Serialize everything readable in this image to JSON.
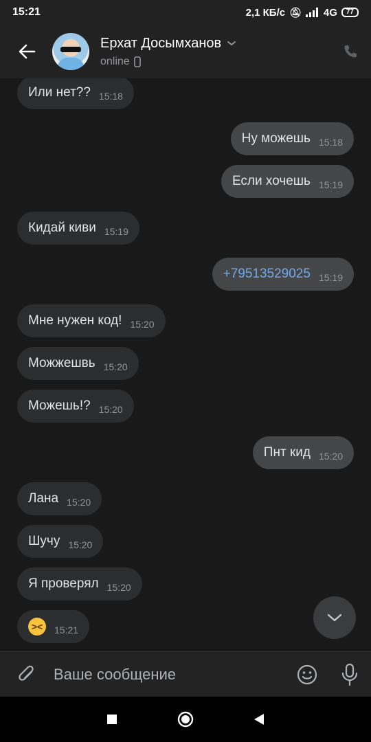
{
  "statusbar": {
    "time": "15:21",
    "speed": "2,1 КБ/с",
    "network": "4G",
    "battery": "77"
  },
  "header": {
    "name": "Ерхат Досымханов",
    "status": "online"
  },
  "messages": [
    {
      "dir": "in",
      "text": "Или нет??",
      "time": "15:18"
    },
    {
      "dir": "out",
      "text": "Ну можешь",
      "time": "15:18"
    },
    {
      "dir": "out",
      "text": "Если хочешь",
      "time": "15:19"
    },
    {
      "dir": "in",
      "text": "Кидай киви",
      "time": "15:19"
    },
    {
      "dir": "out",
      "text": "+79513529025",
      "time": "15:19",
      "link": true
    },
    {
      "dir": "in",
      "text": "Мне нужен код!",
      "time": "15:20"
    },
    {
      "dir": "in",
      "text": "Можжешвь",
      "time": "15:20"
    },
    {
      "dir": "in",
      "text": "Можешь!?",
      "time": "15:20"
    },
    {
      "dir": "out",
      "text": "Пнт кид",
      "time": "15:20"
    },
    {
      "dir": "in",
      "text": "Лана",
      "time": "15:20"
    },
    {
      "dir": "in",
      "text": "Шучу",
      "time": "15:20"
    },
    {
      "dir": "in",
      "text": "Я проверял",
      "time": "15:20"
    },
    {
      "dir": "in",
      "emoji": "laughing-squinting-face",
      "time": "15:21"
    }
  ],
  "composer": {
    "placeholder": "Ваше сообщение"
  },
  "colors": {
    "background": "#19191a",
    "bubble_in": "#2c2d2e",
    "bubble_out": "#454647",
    "link": "#71aaeb",
    "muted": "#939699"
  }
}
